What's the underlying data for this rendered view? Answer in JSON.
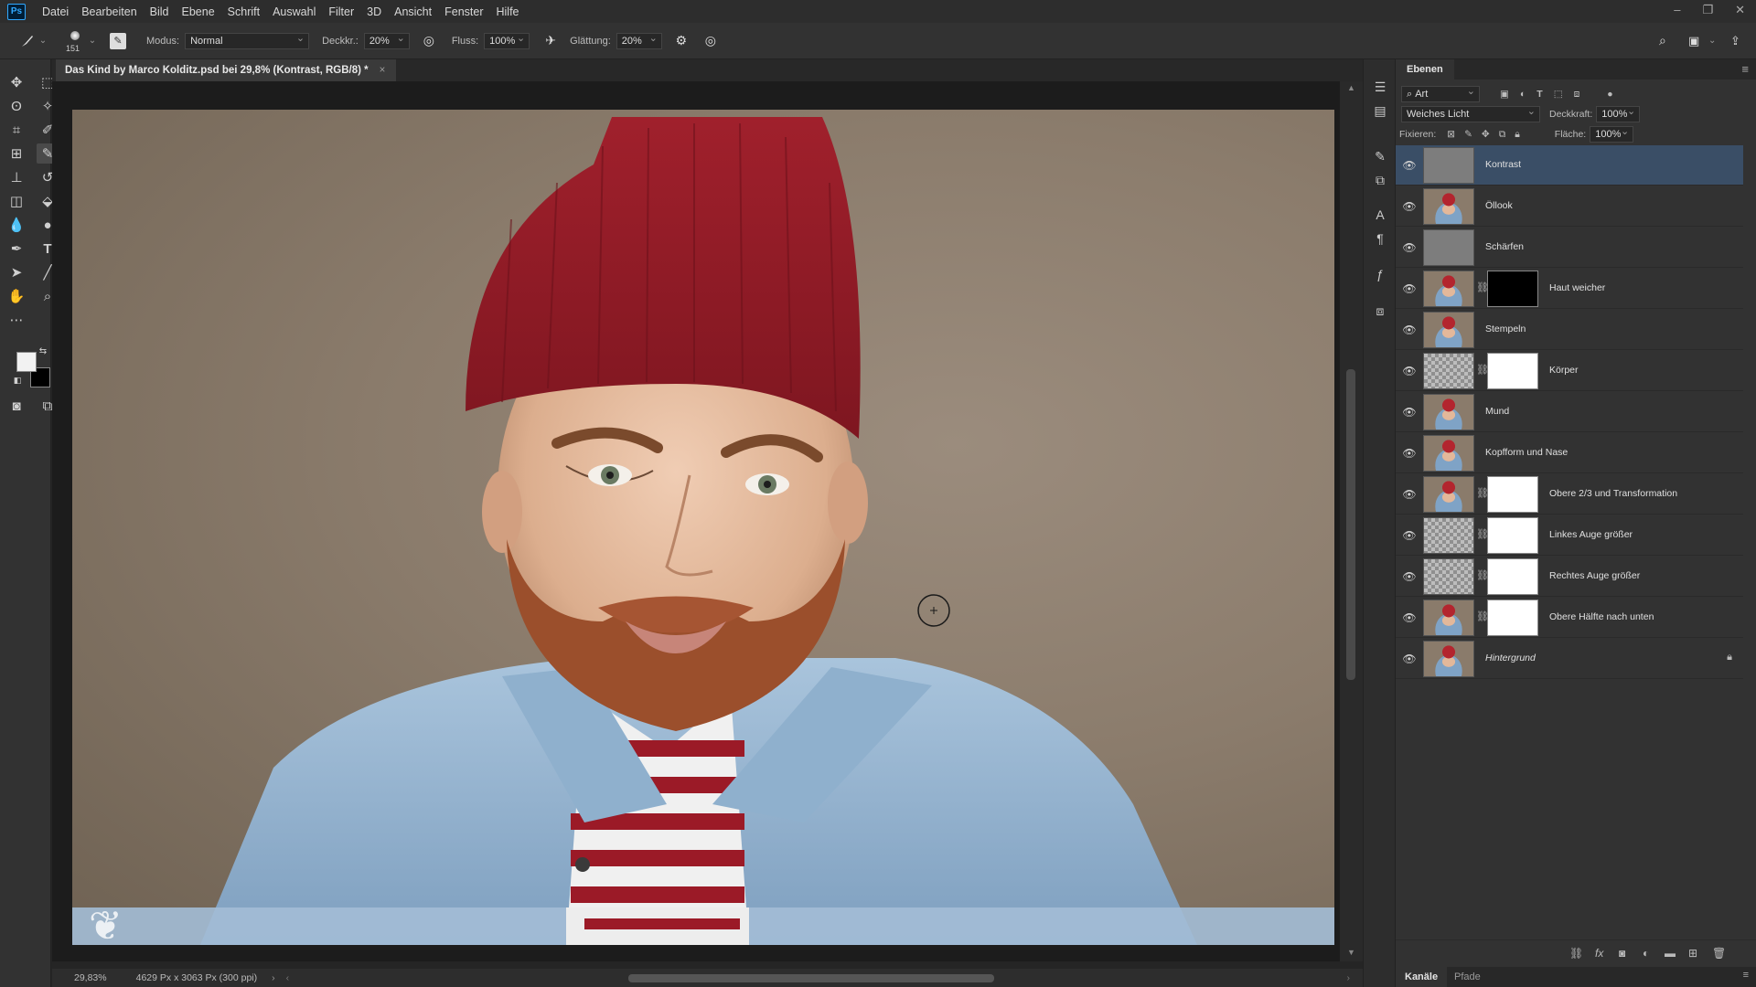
{
  "app": {
    "logo": "Ps"
  },
  "menu": [
    "Datei",
    "Bearbeiten",
    "Bild",
    "Ebene",
    "Schrift",
    "Auswahl",
    "Filter",
    "3D",
    "Ansicht",
    "Fenster",
    "Hilfe"
  ],
  "options": {
    "brush_size": "151",
    "modus_label": "Modus:",
    "modus_value": "Normal",
    "deckkraft_label": "Deckkr.:",
    "deckkraft_value": "20%",
    "fluss_label": "Fluss:",
    "fluss_value": "100%",
    "glaettung_label": "Glättung:",
    "glaettung_value": "20%"
  },
  "document": {
    "tab_title": "Das Kind by Marco Kolditz.psd bei 29,8% (Kontrast, RGB/8) *",
    "close": "×"
  },
  "status": {
    "zoom": "29,83%",
    "doc_info": "4629 Px x 3063 Px (300 ppi)"
  },
  "layers_panel": {
    "tab": "Ebenen",
    "filter_kind": "Art",
    "blend_mode": "Weiches Licht",
    "opacity_label": "Deckkraft:",
    "opacity_value": "100%",
    "lock_label": "Fixieren:",
    "fill_label": "Fläche:",
    "fill_value": "100%",
    "layers": [
      {
        "name": "Kontrast",
        "thumb": "gray",
        "mask": null,
        "selected": true
      },
      {
        "name": "Öllook",
        "thumb": "face",
        "mask": null
      },
      {
        "name": "Schärfen",
        "thumb": "gray",
        "mask": null
      },
      {
        "name": "Haut weicher",
        "thumb": "face",
        "mask": "black"
      },
      {
        "name": "Stempeln",
        "thumb": "face",
        "mask": null
      },
      {
        "name": "Körper",
        "thumb": "checker",
        "mask": "white"
      },
      {
        "name": "Mund",
        "thumb": "face",
        "mask": null
      },
      {
        "name": "Kopfform und Nase",
        "thumb": "face",
        "mask": null
      },
      {
        "name": "Obere 2/3 und Transformation",
        "thumb": "face",
        "mask": "white"
      },
      {
        "name": "Linkes Auge größer",
        "thumb": "checker",
        "mask": "white"
      },
      {
        "name": "Rechtes Auge größer",
        "thumb": "checker",
        "mask": "white"
      },
      {
        "name": "Obere Hälfte nach unten",
        "thumb": "face",
        "mask": "white"
      },
      {
        "name": "Hintergrund",
        "thumb": "face",
        "mask": null,
        "locked": true
      }
    ],
    "bottom_tabs": [
      "Kanäle",
      "Pfade"
    ]
  }
}
